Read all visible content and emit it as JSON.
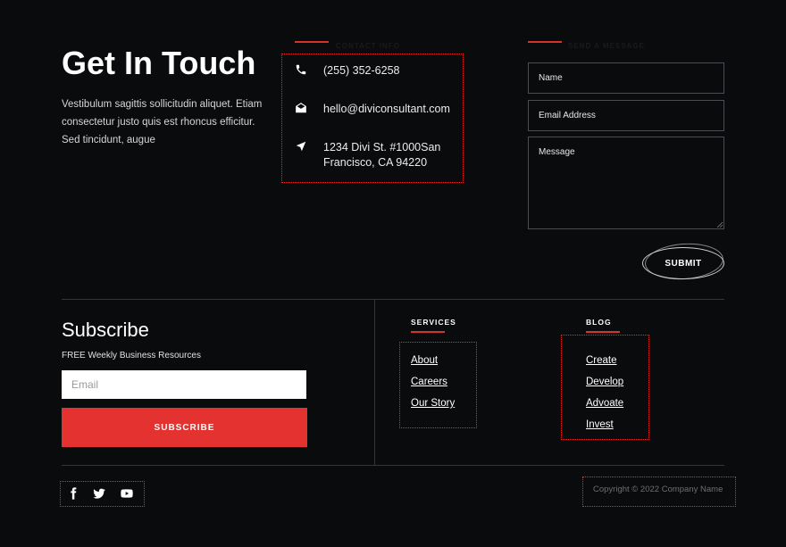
{
  "contact": {
    "title": "Get In Touch",
    "description": "Vestibulum sagittis sollicitudin aliquet. Etiam consectetur justo quis est rhoncus efficitur. Sed tincidunt, augue",
    "info_heading": "CONTACT INFO",
    "phone": "(255) 352-6258",
    "email": "hello@diviconsultant.com",
    "address_line1": "1234 Divi St. #1000San",
    "address_line2": "Francisco, CA 94220"
  },
  "form": {
    "heading": "SEND A MESSAGE",
    "name_placeholder": "Name",
    "email_placeholder": "Email Address",
    "message_placeholder": "Message",
    "submit_label": "SUBMIT"
  },
  "subscribe": {
    "title": "Subscribe",
    "description": "FREE Weekly Business Resources",
    "email_placeholder": "Email",
    "button_label": "SUBSCRIBE"
  },
  "services": {
    "heading": "SERVICES",
    "links": [
      "About",
      "Careers",
      "Our Story"
    ]
  },
  "blog": {
    "heading": "BLOG",
    "links": [
      "Create",
      "Develop",
      "Advoate",
      "Invest"
    ]
  },
  "social": {
    "icons": [
      "facebook-icon",
      "twitter-icon",
      "youtube-icon"
    ]
  },
  "footer": {
    "copyright": "Copyright © 2022 Company Name"
  },
  "colors": {
    "background": "#0a0b0d",
    "accent": "#e3322f",
    "outline": "#e03030"
  }
}
